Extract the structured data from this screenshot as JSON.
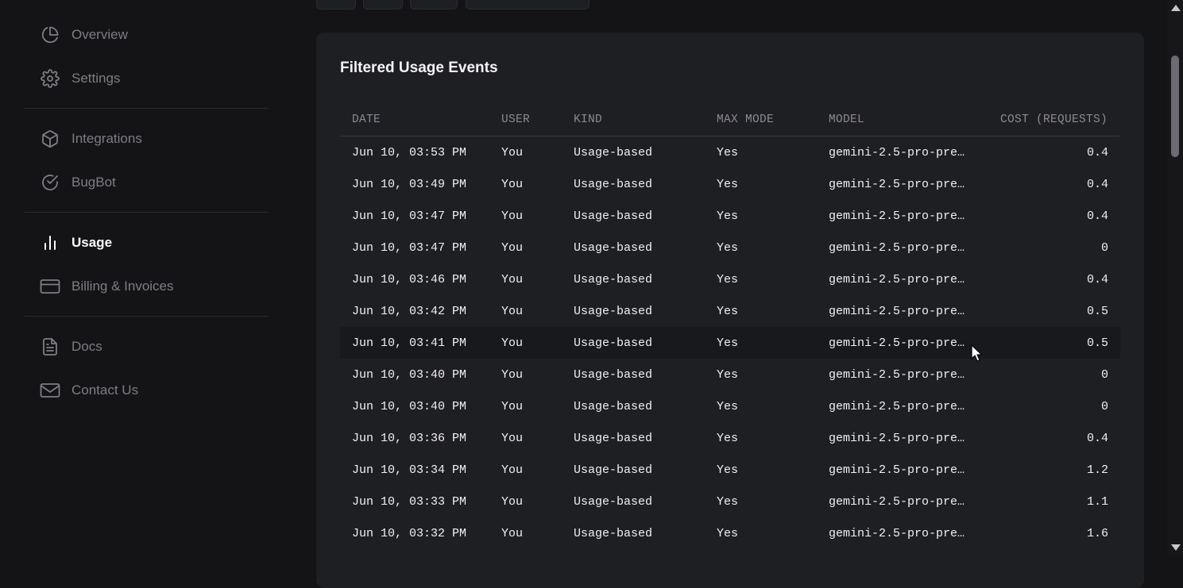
{
  "sidebar": {
    "items": [
      {
        "label": "Overview",
        "icon": "pie-chart-icon"
      },
      {
        "label": "Settings",
        "icon": "gear-icon"
      },
      {
        "label": "Integrations",
        "icon": "box-icon"
      },
      {
        "label": "BugBot",
        "icon": "check-circle-icon"
      },
      {
        "label": "Usage",
        "icon": "bar-chart-icon",
        "active": true
      },
      {
        "label": "Billing & Invoices",
        "icon": "credit-card-icon"
      },
      {
        "label": "Docs",
        "icon": "document-icon"
      },
      {
        "label": "Contact Us",
        "icon": "mail-icon"
      }
    ]
  },
  "card": {
    "title": "Filtered Usage Events",
    "columns": {
      "date": "DATE",
      "user": "USER",
      "kind": "KIND",
      "max_mode": "MAX MODE",
      "model": "MODEL",
      "cost": "COST (REQUESTS)"
    },
    "rows": [
      {
        "date": "Jun 10, 03:53 PM",
        "user": "You",
        "kind": "Usage-based",
        "max_mode": "Yes",
        "model": "gemini-2.5-pro-pre…",
        "cost": "0.4"
      },
      {
        "date": "Jun 10, 03:49 PM",
        "user": "You",
        "kind": "Usage-based",
        "max_mode": "Yes",
        "model": "gemini-2.5-pro-pre…",
        "cost": "0.4"
      },
      {
        "date": "Jun 10, 03:47 PM",
        "user": "You",
        "kind": "Usage-based",
        "max_mode": "Yes",
        "model": "gemini-2.5-pro-pre…",
        "cost": "0.4"
      },
      {
        "date": "Jun 10, 03:47 PM",
        "user": "You",
        "kind": "Usage-based",
        "max_mode": "Yes",
        "model": "gemini-2.5-pro-pre…",
        "cost": "0"
      },
      {
        "date": "Jun 10, 03:46 PM",
        "user": "You",
        "kind": "Usage-based",
        "max_mode": "Yes",
        "model": "gemini-2.5-pro-pre…",
        "cost": "0.4"
      },
      {
        "date": "Jun 10, 03:42 PM",
        "user": "You",
        "kind": "Usage-based",
        "max_mode": "Yes",
        "model": "gemini-2.5-pro-pre…",
        "cost": "0.5"
      },
      {
        "date": "Jun 10, 03:41 PM",
        "user": "You",
        "kind": "Usage-based",
        "max_mode": "Yes",
        "model": "gemini-2.5-pro-pre…",
        "cost": "0.5"
      },
      {
        "date": "Jun 10, 03:40 PM",
        "user": "You",
        "kind": "Usage-based",
        "max_mode": "Yes",
        "model": "gemini-2.5-pro-pre…",
        "cost": "0"
      },
      {
        "date": "Jun 10, 03:40 PM",
        "user": "You",
        "kind": "Usage-based",
        "max_mode": "Yes",
        "model": "gemini-2.5-pro-pre…",
        "cost": "0"
      },
      {
        "date": "Jun 10, 03:36 PM",
        "user": "You",
        "kind": "Usage-based",
        "max_mode": "Yes",
        "model": "gemini-2.5-pro-pre…",
        "cost": "0.4"
      },
      {
        "date": "Jun 10, 03:34 PM",
        "user": "You",
        "kind": "Usage-based",
        "max_mode": "Yes",
        "model": "gemini-2.5-pro-pre…",
        "cost": "1.2"
      },
      {
        "date": "Jun 10, 03:33 PM",
        "user": "You",
        "kind": "Usage-based",
        "max_mode": "Yes",
        "model": "gemini-2.5-pro-pre…",
        "cost": "1.1"
      },
      {
        "date": "Jun 10, 03:32 PM",
        "user": "You",
        "kind": "Usage-based",
        "max_mode": "Yes",
        "model": "gemini-2.5-pro-pre…",
        "cost": "1.6"
      }
    ]
  },
  "colors": {
    "background": "#141417",
    "card": "#1e1f23",
    "text": "#f0f0f2",
    "muted": "#7d7d84"
  }
}
